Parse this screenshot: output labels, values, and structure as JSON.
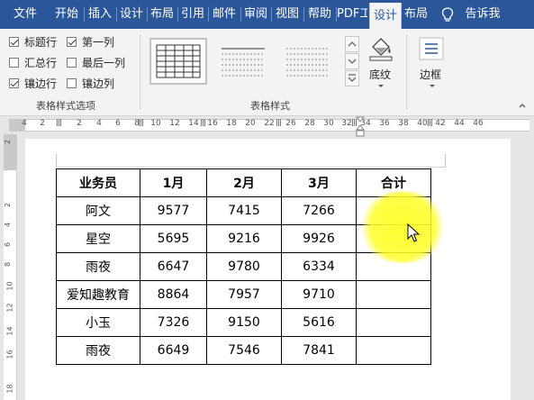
{
  "ribbon_tabs": [
    "文件",
    "开始",
    "插入",
    "设计",
    "布局",
    "引用",
    "邮件",
    "审阅",
    "视图",
    "帮助",
    "PDF工",
    "设计",
    "布局"
  ],
  "tell_me": "告诉我",
  "style_options": {
    "header_row": {
      "label": "标题行",
      "checked": true
    },
    "first_column": {
      "label": "第一列",
      "checked": true
    },
    "total_row": {
      "label": "汇总行",
      "checked": false
    },
    "last_column": {
      "label": "最后一列",
      "checked": false
    },
    "banded_rows": {
      "label": "镶边行",
      "checked": true
    },
    "banded_columns": {
      "label": "镶边列",
      "checked": false
    },
    "group_label": "表格样式选项"
  },
  "table_styles": {
    "group_label": "表格样式",
    "shading_label": "底纹"
  },
  "borders": {
    "label": "边框"
  },
  "ruler_numbers": [
    "4",
    "2",
    "2",
    "4",
    "6",
    "8",
    "10",
    "12",
    "14",
    "16",
    "18",
    "20",
    "22",
    "26",
    "28",
    "30",
    "32",
    "34",
    "36",
    "38",
    "40",
    "42",
    "44",
    "46"
  ],
  "vruler_numbers": [
    "2",
    "2",
    "4",
    "6",
    "8",
    "10",
    "12",
    "14",
    "16",
    "18"
  ],
  "table": {
    "headers": [
      "业务员",
      "1月",
      "2月",
      "3月",
      "合计"
    ],
    "rows": [
      [
        "阿文",
        "9577",
        "7415",
        "7266",
        ""
      ],
      [
        "星空",
        "5695",
        "9216",
        "9926",
        ""
      ],
      [
        "雨夜",
        "6647",
        "9780",
        "6334",
        ""
      ],
      [
        "爱知趣教育",
        "8864",
        "7957",
        "9710",
        ""
      ],
      [
        "小玉",
        "7326",
        "9150",
        "5616",
        ""
      ],
      [
        "雨夜",
        "6649",
        "7546",
        "7841",
        ""
      ]
    ]
  },
  "colors": {
    "ribbon_blue": "#2b579a",
    "highlight": "#ffff28"
  }
}
